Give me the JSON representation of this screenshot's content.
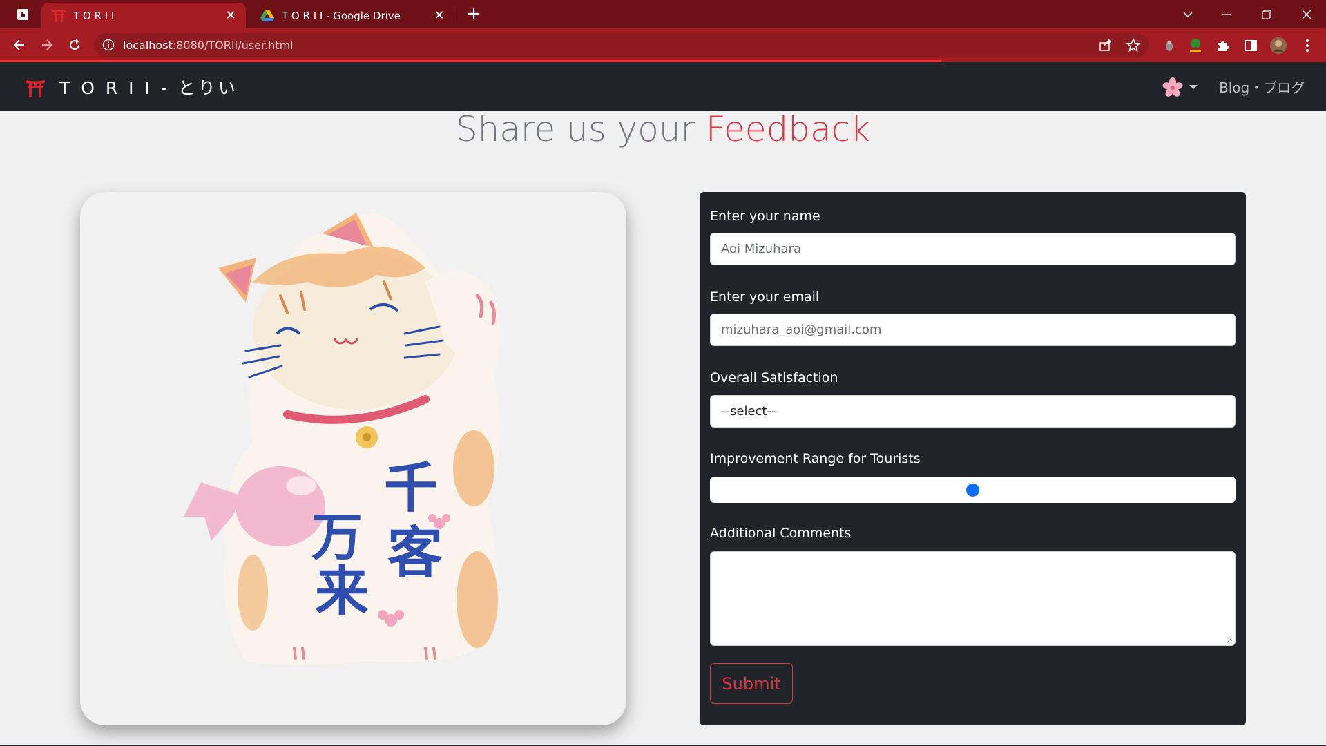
{
  "browser": {
    "tabs": [
      {
        "title": "T O R I I",
        "close": "✕"
      },
      {
        "title": "T O R I I - Google Drive",
        "close": "✕"
      }
    ],
    "new_tab": "+",
    "url_host": "localhost",
    "url_path": ":8080/TORII/user.html",
    "colors": {
      "frame": "#6e1015",
      "active_tab": "#a51c22",
      "load_bar": "#ff2b2b"
    },
    "page_load_progress": 0.71
  },
  "navbar": {
    "brand": "T O R I I - とりい",
    "blog_link": "Blog・ブログ",
    "icons": [
      "torii-gate-icon",
      "sakura-icon",
      "caret-down-icon"
    ]
  },
  "heading": {
    "prefix": "Share us your ",
    "accent": "Feedback",
    "accent_color": "#dc3545"
  },
  "image_card": {
    "subject": "maneki-neko-illustration",
    "calligraphy": [
      "千",
      "客",
      "万",
      "来"
    ]
  },
  "form": {
    "name_label": "Enter your name",
    "name_value": "Aoi Mizuhara",
    "email_label": "Enter your email",
    "email_value": "mizuhara_aoi@gmail.com",
    "satisfaction_label": "Overall Satisfaction",
    "satisfaction_selected": "--select--",
    "improvement_label": "Improvement Range for Tourists",
    "improvement_value_fraction": 0.5,
    "comments_label": "Additional Comments",
    "comments_value": "",
    "submit_label": "Submit",
    "thumb_color": "#0d6efd"
  }
}
